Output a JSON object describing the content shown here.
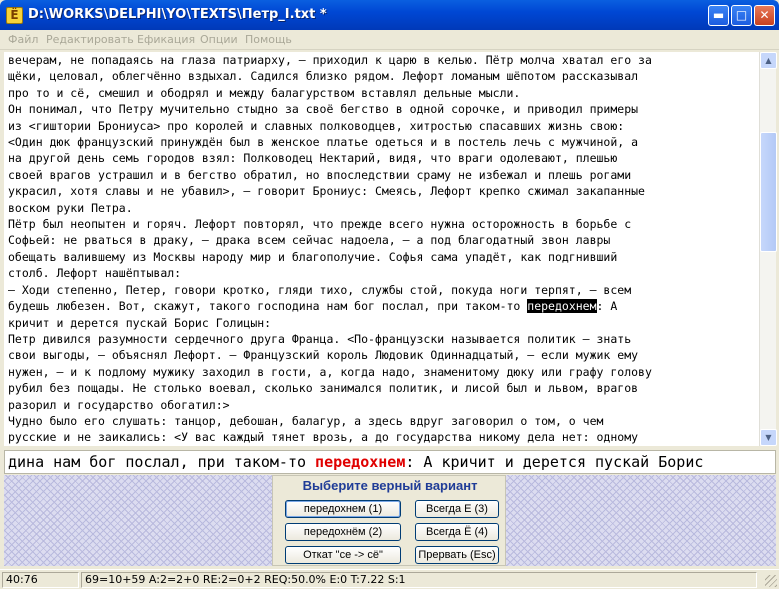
{
  "window": {
    "title": "D:\\WORKS\\DELPHI\\YO\\TEXTS\\Петр_I.txt *",
    "app_icon_letter": "Ё",
    "icons": {
      "minimize": "minimize-icon",
      "maximize": "maximize-icon",
      "close": "close-icon"
    }
  },
  "menu": [
    "Файл",
    "Редактировать",
    "Ефикация",
    "Опции",
    "Помощь"
  ],
  "editor": {
    "lines": [
      "вечерам, не попадаясь на глаза патриарху, – приходил к царю в келью. Пётр молча хватал его за",
      "щёки, целовал, облегчённо вздыхал. Садился близко рядом. Лефорт ломаным шёпотом рассказывал",
      "про то и сё, смешил и ободрял и между балагурством вставлял дельные мысли.",
      "Он понимал, что Петру мучительно стыдно за своё бегство в одной сорочке, и приводил примеры",
      "из <гиштории Брониуса> про королей и славных полководцев, хитростью спасавших жизнь свою:",
      "<Один дюк французский принуждён был в женское платье одеться и в постель лечь с мужчиной, а",
      "на другой день семь городов взял: Полководец Нектарий, видя, что враги одолевают, плешью",
      "своей врагов устрашил и в бегство обратил, но впоследствии сраму не избежал и плешь рогами",
      "украсил, хотя славы и не убавил>, – говорит Брониус: Смеясь, Лефорт крепко сжимал закапанные",
      "воском руки Петра.",
      "Пётр был неопытен и горяч. Лефорт повторял, что прежде всего нужна осторожность в борьбе с",
      "Софьей: не рваться в драку, – драка всем сейчас надоела, – а под благодатный звон лавры",
      "обещать валившему из Москвы народу мир и благополучие. Софья сама упадёт, как подгнивший",
      "столб. Лефорт нашёптывал:",
      "– Ходи степенно, Петер, говори кротко, гляди тихо, службы стой, покуда ноги терпят, – всем",
      "будешь любезен. Вот, скажут, такого господина нам бог послал, при таком-то ",
      "кричит и дерется пускай Борис Голицын:",
      "Петр дивился разумности сердечного друга Франца. <По-французски называется политик – знать",
      "свои выгоды, – объяснял Лефорт. – Французский король Людовик Одиннадцатый, – если мужик ему",
      "нужен, – и к подлому мужику заходил в гости, а, когда надо, знаменитому дюку или графу голову",
      "рубил без пощады. Не столько воевал, сколько занимался политик, и лисой был и львом, врагов",
      "разорил и государство обогатил:>",
      "Чудно было его слушать: танцор, дебошан, балагур, а здесь вдруг заговорил о том, о чем",
      "русские и не заикались: <У вас каждый тянет врозь, а до государства никому дела нет: одному"
    ],
    "highlight_word": "передохнем",
    "highlight_after": ": А"
  },
  "preview": {
    "before": "дина нам бог послал, при таком-то ",
    "word": "передохнем",
    "after": ": А кричит и дерется пускай Борис"
  },
  "dialog": {
    "title": "Выберите верный вариант",
    "buttons": {
      "opt1": "передохнем (1)",
      "opt2": "передохнём (2)",
      "always_e": "Всегда Е (3)",
      "always_yo": "Всегда Ё (4)",
      "rollback": "Откат \"се -> сё\"",
      "abort": "Прервать (Esc)"
    }
  },
  "status": {
    "position": "40:76",
    "stats": "69=10+59 A:2=2+0 RE:2=0+2 REQ:50.0% E:0 T:7.22 S:1"
  }
}
